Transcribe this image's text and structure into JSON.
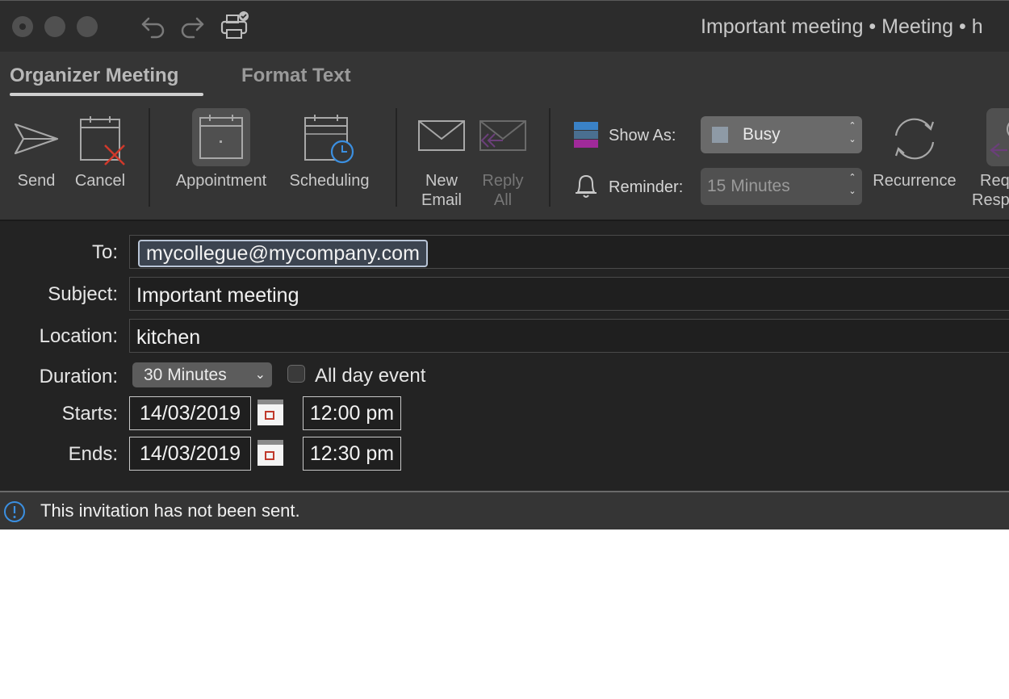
{
  "window": {
    "title": "Important meeting • Meeting • h"
  },
  "ribbon_tabs": [
    {
      "label": "Organizer Meeting",
      "active": true
    },
    {
      "label": "Format Text",
      "active": false
    }
  ],
  "ribbon": {
    "send": "Send",
    "cancel": "Cancel",
    "appointment": "Appointment",
    "scheduling": "Scheduling",
    "new_email_line1": "New",
    "new_email_line2": "Email",
    "reply_all_line1": "Reply",
    "reply_all_line2": "All",
    "show_as_label": "Show As:",
    "show_as_value": "Busy",
    "reminder_label": "Reminder:",
    "reminder_value": "15 Minutes",
    "recurrence": "Recurrence",
    "request_responses_line1": "Req",
    "request_responses_line2": "Resp"
  },
  "form": {
    "to_label": "To:",
    "to_recipient": "mycollegue@mycompany.com",
    "subject_label": "Subject:",
    "subject_value": "Important meeting",
    "location_label": "Location:",
    "location_value": "kitchen",
    "duration_label": "Duration:",
    "duration_value": "30 Minutes",
    "all_day_label": "All day event",
    "all_day_checked": false,
    "starts_label": "Starts:",
    "starts_date": "14/03/2019",
    "starts_time": "12:00 pm",
    "ends_label": "Ends:",
    "ends_date": "14/03/2019",
    "ends_time": "12:30 pm"
  },
  "status": {
    "message": "This invitation has not been sent."
  },
  "colors": {
    "titlebar": "#2c2c2c",
    "ribbon": "#353535",
    "form_bg": "#232323",
    "accent_blue": "#3b8fe0",
    "busy_swatch": "#8e9aa6",
    "calendar_red": "#c0392b",
    "show_as_magenta": "#a02a9a"
  }
}
